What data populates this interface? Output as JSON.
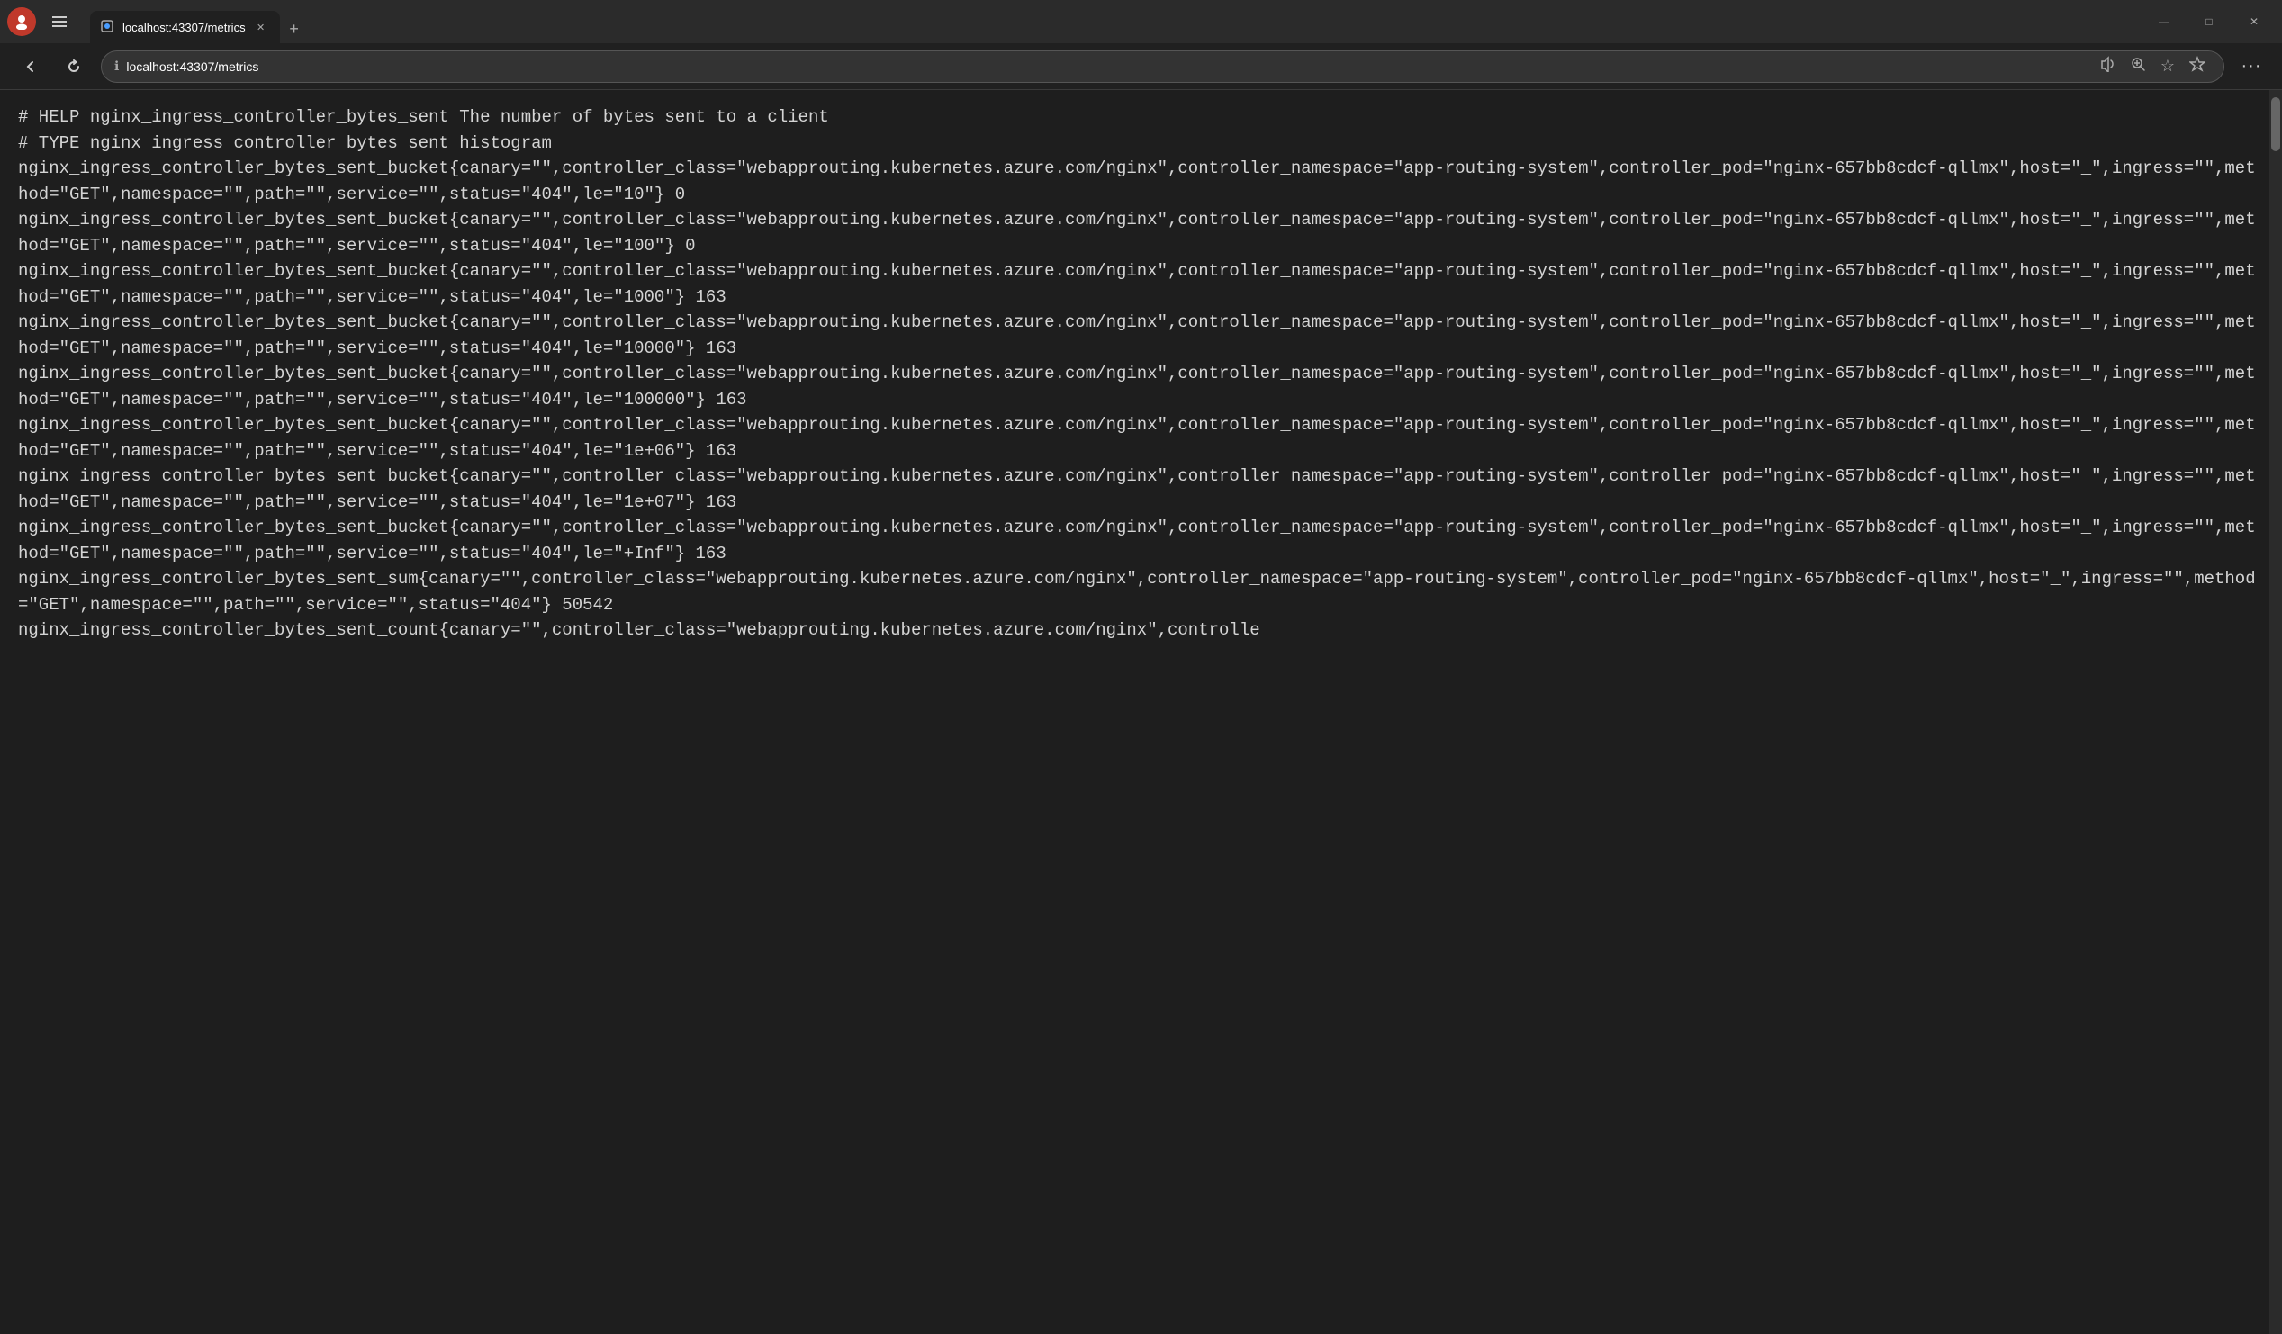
{
  "browser": {
    "title": "localhost:43307/metrics",
    "url": "localhost:43307/metrics",
    "tab_label": "localhost:43307/metrics"
  },
  "toolbar": {
    "back_label": "←",
    "refresh_label": "↻",
    "info_icon": "ℹ",
    "read_aloud_icon": "📢",
    "zoom_icon": "🔍",
    "favorites_icon": "☆",
    "collections_icon": "⭐",
    "more_icon": "…",
    "minimize_label": "—",
    "maximize_label": "□",
    "close_label": "✕"
  },
  "content": {
    "lines": [
      "# HELP nginx_ingress_controller_bytes_sent The number of bytes sent to a client",
      "# TYPE nginx_ingress_controller_bytes_sent histogram",
      "nginx_ingress_controller_bytes_sent_bucket{canary=\"\",controller_class=\"webapprouting.kubernetes.azure.com/nginx\",controller_namespace=\"app-routing-system\",controller_pod=\"nginx-657bb8cdcf-qllmx\",host=\"_\",ingress=\"\",method=\"GET\",namespace=\"\",path=\"\",service=\"\",status=\"404\",le=\"10\"} 0",
      "nginx_ingress_controller_bytes_sent_bucket{canary=\"\",controller_class=\"webapprouting.kubernetes.azure.com/nginx\",controller_namespace=\"app-routing-system\",controller_pod=\"nginx-657bb8cdcf-qllmx\",host=\"_\",ingress=\"\",method=\"GET\",namespace=\"\",path=\"\",service=\"\",status=\"404\",le=\"100\"} 0",
      "nginx_ingress_controller_bytes_sent_bucket{canary=\"\",controller_class=\"webapprouting.kubernetes.azure.com/nginx\",controller_namespace=\"app-routing-system\",controller_pod=\"nginx-657bb8cdcf-qllmx\",host=\"_\",ingress=\"\",method=\"GET\",namespace=\"\",path=\"\",service=\"\",status=\"404\",le=\"1000\"} 163",
      "nginx_ingress_controller_bytes_sent_bucket{canary=\"\",controller_class=\"webapprouting.kubernetes.azure.com/nginx\",controller_namespace=\"app-routing-system\",controller_pod=\"nginx-657bb8cdcf-qllmx\",host=\"_\",ingress=\"\",method=\"GET\",namespace=\"\",path=\"\",service=\"\",status=\"404\",le=\"10000\"} 163",
      "nginx_ingress_controller_bytes_sent_bucket{canary=\"\",controller_class=\"webapprouting.kubernetes.azure.com/nginx\",controller_namespace=\"app-routing-system\",controller_pod=\"nginx-657bb8cdcf-qllmx\",host=\"_\",ingress=\"\",method=\"GET\",namespace=\"\",path=\"\",service=\"\",status=\"404\",le=\"100000\"} 163",
      "nginx_ingress_controller_bytes_sent_bucket{canary=\"\",controller_class=\"webapprouting.kubernetes.azure.com/nginx\",controller_namespace=\"app-routing-system\",controller_pod=\"nginx-657bb8cdcf-qllmx\",host=\"_\",ingress=\"\",method=\"GET\",namespace=\"\",path=\"\",service=\"\",status=\"404\",le=\"1e+06\"} 163",
      "nginx_ingress_controller_bytes_sent_bucket{canary=\"\",controller_class=\"webapprouting.kubernetes.azure.com/nginx\",controller_namespace=\"app-routing-system\",controller_pod=\"nginx-657bb8cdcf-qllmx\",host=\"_\",ingress=\"\",method=\"GET\",namespace=\"\",path=\"\",service=\"\",status=\"404\",le=\"1e+07\"} 163",
      "nginx_ingress_controller_bytes_sent_bucket{canary=\"\",controller_class=\"webapprouting.kubernetes.azure.com/nginx\",controller_namespace=\"app-routing-system\",controller_pod=\"nginx-657bb8cdcf-qllmx\",host=\"_\",ingress=\"\",method=\"GET\",namespace=\"\",path=\"\",service=\"\",status=\"404\",le=\"+Inf\"} 163",
      "nginx_ingress_controller_bytes_sent_sum{canary=\"\",controller_class=\"webapprouting.kubernetes.azure.com/nginx\",controller_namespace=\"app-routing-system\",controller_pod=\"nginx-657bb8cdcf-qllmx\",host=\"_\",ingress=\"\",method=\"GET\",namespace=\"\",path=\"\",service=\"\",status=\"404\"} 50542",
      "nginx_ingress_controller_bytes_sent_count{canary=\"\",controller_class=\"webapprouting.kubernetes.azure.com/nginx\",controlle"
    ]
  }
}
